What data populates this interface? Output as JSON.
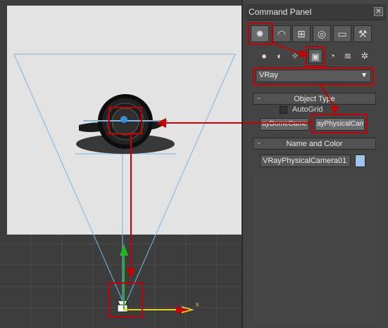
{
  "panel": {
    "title": "Command Panel",
    "close_icon": "close-icon",
    "tabs": [
      {
        "name": "create-tab",
        "icon": "sun-gear-icon",
        "active": true
      },
      {
        "name": "modify-tab",
        "icon": "modify-curve-icon"
      },
      {
        "name": "hierarchy-tab",
        "icon": "hierarchy-icon"
      },
      {
        "name": "motion-tab",
        "icon": "motion-icon"
      },
      {
        "name": "display-tab",
        "icon": "monitor-icon"
      },
      {
        "name": "utilities-tab",
        "icon": "hammer-icon"
      }
    ],
    "categories": [
      {
        "name": "geometry-category",
        "icon": "sphere-icon",
        "glyph": "●"
      },
      {
        "name": "shapes-category",
        "icon": "shapes-icon",
        "glyph": "◐"
      },
      {
        "name": "lights-category",
        "icon": "light-icon",
        "glyph": "✧"
      },
      {
        "name": "cameras-category",
        "icon": "camera-icon",
        "glyph": "▣",
        "active": true
      },
      {
        "name": "helpers-category",
        "icon": "helper-icon",
        "glyph": "◔"
      },
      {
        "name": "spacewarps-category",
        "icon": "spacewarp-icon",
        "glyph": "≋"
      },
      {
        "name": "systems-category",
        "icon": "systems-icon",
        "glyph": "✲"
      }
    ],
    "dropdown": {
      "value": "VRay"
    },
    "object_type": {
      "minus": "-",
      "title": "Object Type",
      "autogrid_label": "AutoGrid",
      "buttons": [
        "ayDomeCame",
        "ayPhysicalCam"
      ]
    },
    "name_color": {
      "minus": "-",
      "title": "Name and Color",
      "name_value": "VRayPhysicalCamera01",
      "color": "#a3c3ef"
    }
  },
  "viewport": {
    "axis_label": "x"
  },
  "colors": {
    "highlight": "#c40000",
    "frustum": "#7ab6e6",
    "gizmo_green": "#1fb81f",
    "gizmo_yellow": "#e3d21b"
  }
}
